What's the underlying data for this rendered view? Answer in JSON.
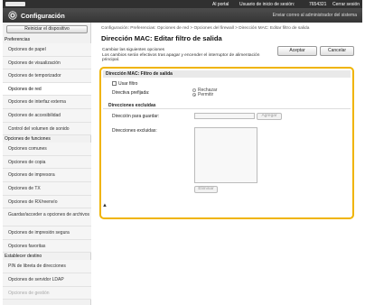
{
  "topbar": {
    "portal": "Al portal",
    "login_label": "Usuario de inicio de sesión:",
    "login_value": "7654321",
    "logout": "Cerrar sesión"
  },
  "header": {
    "title": "Configuración",
    "mail_link": "Enviar correo al administrador del sistema"
  },
  "sidebar": {
    "reset_label": "Reiniciar el dispositivo",
    "entries": [
      {
        "type": "section",
        "label": "Preferencias"
      },
      {
        "type": "item",
        "label": "Opciones de papel"
      },
      {
        "type": "item",
        "label": "Opciones de visualización"
      },
      {
        "type": "item",
        "label": "Opciones de temporizador"
      },
      {
        "type": "item",
        "label": "Opciones de red",
        "active": true
      },
      {
        "type": "item",
        "label": "Opciones de interfaz externa"
      },
      {
        "type": "item",
        "label": "Opciones de accesibilidad"
      },
      {
        "type": "item",
        "label": "Control del volumen de sonido"
      },
      {
        "type": "section",
        "label": "Opciones de funciones"
      },
      {
        "type": "item",
        "label": "Opciones comunes"
      },
      {
        "type": "item",
        "label": "Opciones de copia"
      },
      {
        "type": "item",
        "label": "Opciones de impresora"
      },
      {
        "type": "item",
        "label": "Opciones de TX"
      },
      {
        "type": "item",
        "label": "Opciones de RX/reenvío"
      },
      {
        "type": "item2",
        "label": "Guardar/acceder a opciones de archivos"
      },
      {
        "type": "item",
        "label": "Opciones de impresión segura"
      },
      {
        "type": "item",
        "label": "Opciones favoritas"
      },
      {
        "type": "section",
        "label": "Establecer destino"
      },
      {
        "type": "item",
        "label": "PIN de libreta de direcciones"
      },
      {
        "type": "item",
        "label": "Opciones de servidor LDAP"
      },
      {
        "type": "faded",
        "label": "Opciones de gestión"
      }
    ]
  },
  "main": {
    "breadcrumb": "Configuración: Preferencias: Opciones de red > Opciones del firewall > Dirección MAC: Editar filtro de salida",
    "title": "Dirección MAC: Editar filtro de salida",
    "ok_label": "Aceptar",
    "cancel_label": "Cancelar",
    "notice_line1": "Cambiar las siguientes opciones",
    "notice_line2": "Los cambios serán efectivos tras apagar y encender el interruptor de alimentación principal.",
    "box_header": "Dirección MAC: Filtro de salida",
    "use_filter_label": "Usar filtro",
    "use_filter_checked": false,
    "policy_label": "Directiva prefijada:",
    "policy_options": [
      "Rechazar",
      "Permitir"
    ],
    "policy_selected": "Permitir",
    "excluded_header": "Direcciones excluidas",
    "addr_to_register_label": "Dirección para guardar:",
    "addr_value": "",
    "add_label": "Agregar",
    "excluded_list_label": "Direcciones excluidas:",
    "delete_label": "Eliminar",
    "top_link": "▲"
  }
}
